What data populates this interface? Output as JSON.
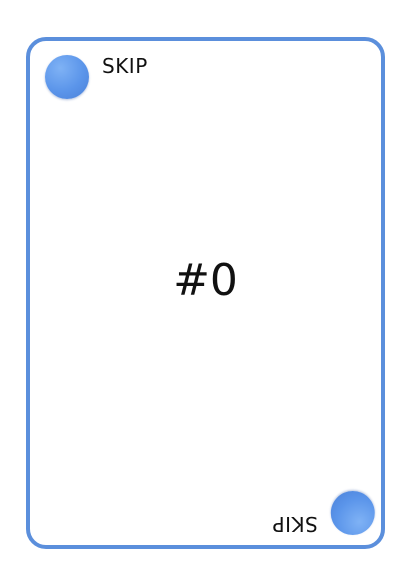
{
  "card": {
    "type_label": "SKIP",
    "number": "#0",
    "border_color": "#5b8fdc",
    "dot_color": "#5b95ea",
    "corner_icon": "blue-circle-icon"
  }
}
